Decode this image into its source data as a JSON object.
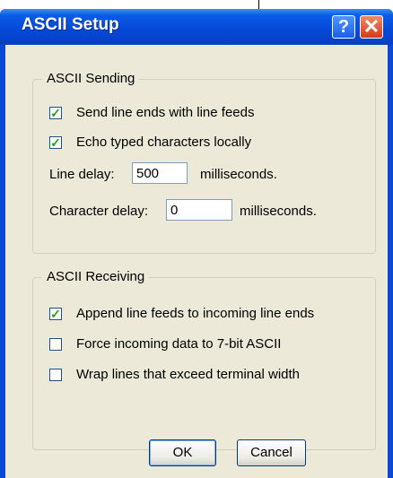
{
  "window": {
    "title": "ASCII Setup",
    "help_glyph": "?",
    "close_glyph": "✕"
  },
  "sending": {
    "legend": "ASCII Sending",
    "options": [
      {
        "label": "Send line ends with line feeds",
        "checked": true
      },
      {
        "label": "Echo typed characters locally",
        "checked": true
      }
    ],
    "line_delay_label": "Line delay:",
    "line_delay_value": "500",
    "line_delay_unit": "milliseconds.",
    "char_delay_label": "Character delay:",
    "char_delay_value": "0",
    "char_delay_unit": "milliseconds."
  },
  "receiving": {
    "legend": "ASCII Receiving",
    "options": [
      {
        "label": "Append line feeds to incoming line ends",
        "checked": true
      },
      {
        "label": "Force incoming data to 7-bit ASCII",
        "checked": false
      },
      {
        "label": "Wrap lines that exceed terminal width",
        "checked": false
      }
    ]
  },
  "buttons": {
    "ok": "OK",
    "cancel": "Cancel"
  },
  "colors": {
    "titlebar": "#0a5be8",
    "dialog_bg": "#ece9d8",
    "close_button": "#d83a16",
    "check_mark": "#21a121"
  }
}
